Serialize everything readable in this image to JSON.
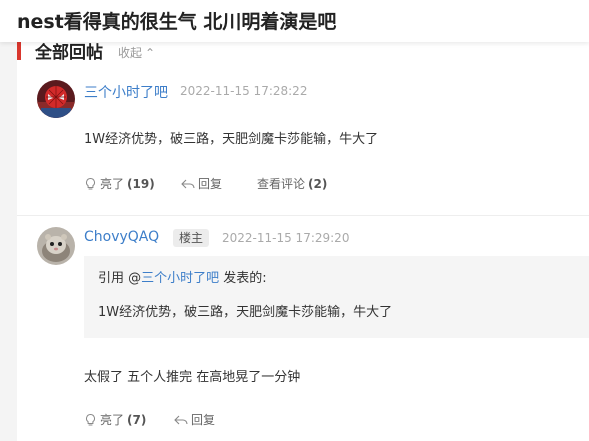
{
  "thread": {
    "title": "nest看得真的很生气 北川明着演是吧"
  },
  "section": {
    "label": "全部回帖",
    "collapse_label": "收起"
  },
  "posts": [
    {
      "username": "三个小时了吧",
      "timestamp": "2022-11-15 17:28:22",
      "content": "1W经济优势，破三路，天肥剑魔卡莎能输，牛大了",
      "actions": {
        "like_label": "亮了",
        "like_count": "(19)",
        "reply_label": "回复",
        "comments_label": "查看评论",
        "comments_count": "(2)"
      }
    },
    {
      "username": "ChovyQAQ",
      "badge": "楼主",
      "timestamp": "2022-11-15 17:29:20",
      "quote": {
        "prefix": "引用 @",
        "user": "三个小时了吧",
        "suffix": " 发表的:",
        "content": "1W经济优势，破三路，天肥剑魔卡莎能输，牛大了"
      },
      "content": "太假了 五个人推完 在高地晃了一分钟",
      "actions": {
        "like_label": "亮了",
        "like_count": "(7)",
        "reply_label": "回复"
      }
    }
  ],
  "icons": {
    "like": "lightbulb-icon",
    "reply": "reply-arrow-icon",
    "collapse": "chevron-up-icon"
  },
  "colors": {
    "accent": "#d9362d",
    "link": "#3d7ec9",
    "muted": "#aaaaaa"
  }
}
